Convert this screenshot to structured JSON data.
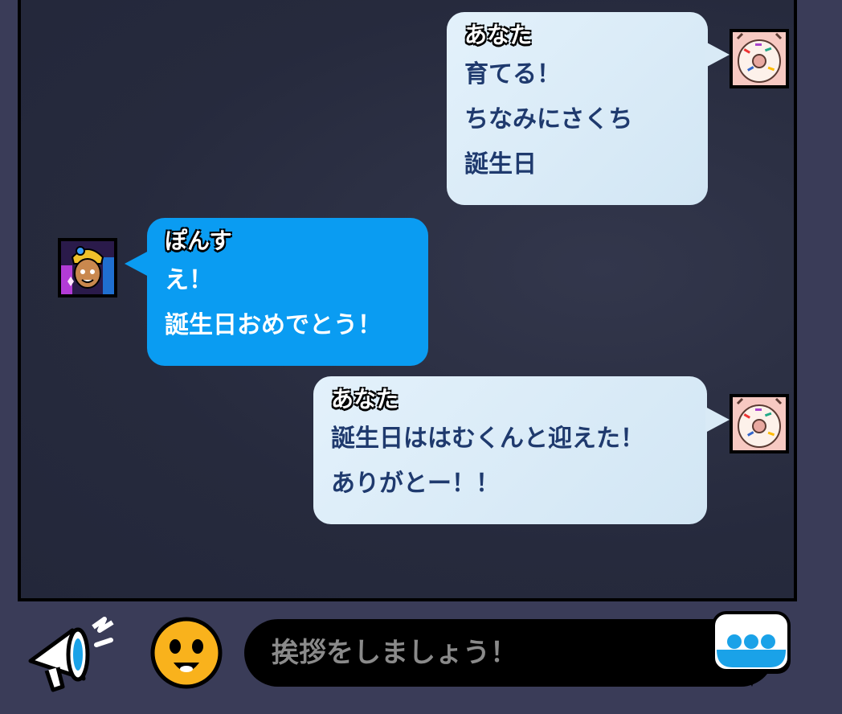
{
  "messages": [
    {
      "sender": "あなた",
      "lines": [
        "育てる！",
        "ちなみにさくち",
        "誕生日"
      ]
    },
    {
      "sender": "ぽんす",
      "lines": [
        "え！",
        "誕生日おめでとう！"
      ]
    },
    {
      "sender": "あなた",
      "lines": [
        "誕生日ははむくんと迎えた！",
        "ありがとー！！"
      ]
    }
  ],
  "input": {
    "placeholder": "挨拶をしましょう！"
  },
  "colors": {
    "my_bubble": "#e0eef8",
    "other_bubble": "#0a9cf2",
    "my_text": "#1f3a6e",
    "background": "#262a3d"
  },
  "icons": [
    "megaphone-icon",
    "emoji-face-icon",
    "send-chat-icon"
  ]
}
